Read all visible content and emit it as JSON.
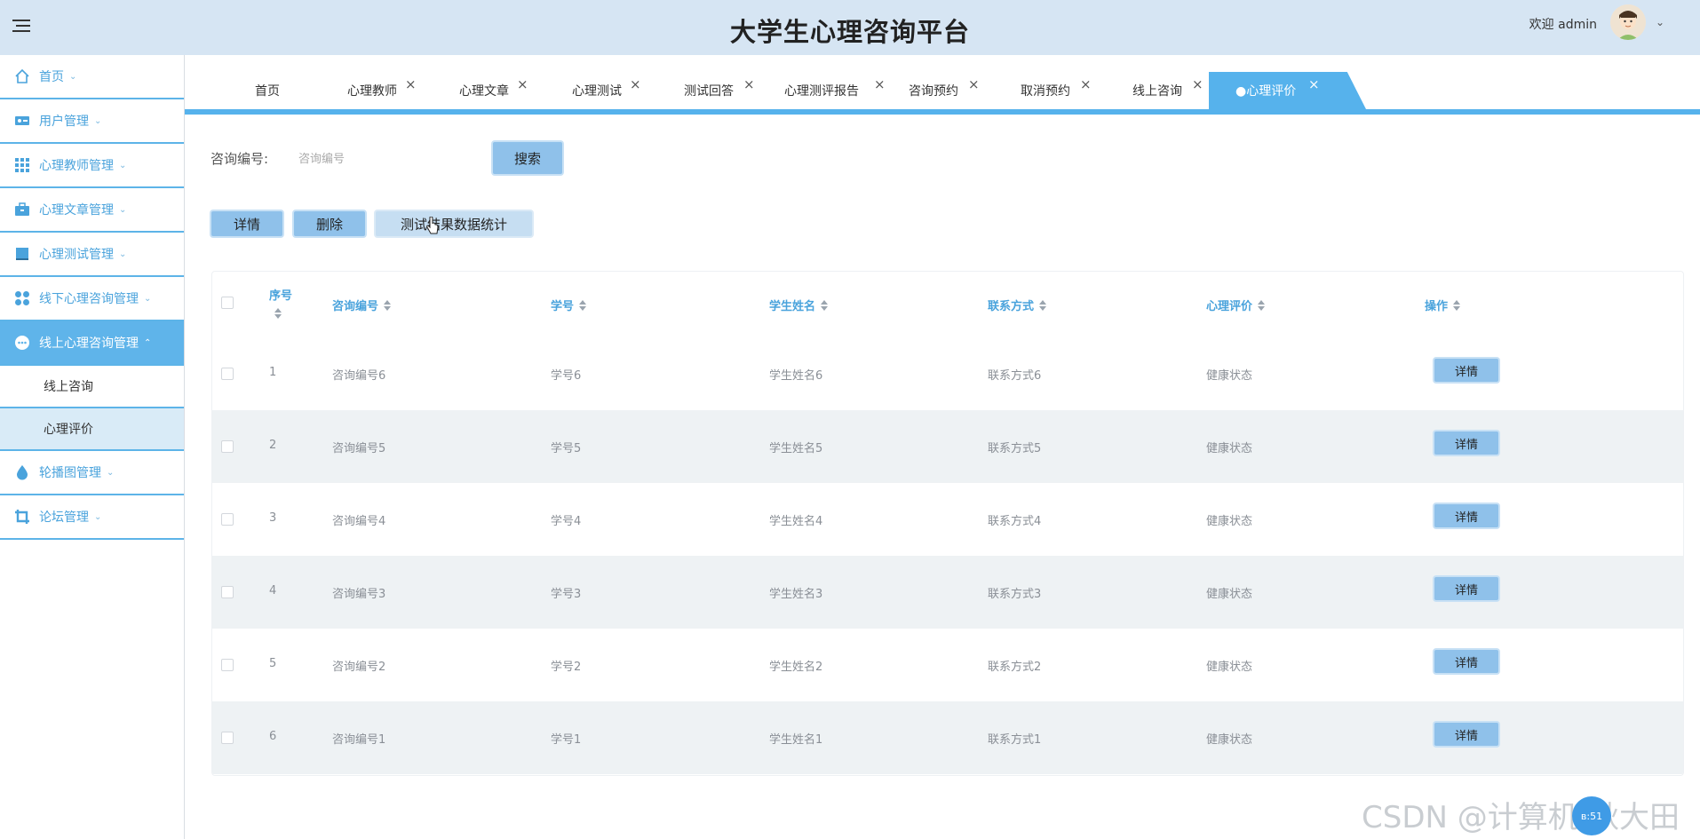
{
  "header": {
    "title": "大学生心理咨询平台",
    "welcome": "欢迎 admin",
    "caret": "⌄"
  },
  "sidebar": {
    "items": [
      {
        "label": "首页",
        "icon": "home-icon"
      },
      {
        "label": "用户管理",
        "icon": "user-card-icon"
      },
      {
        "label": "心理教师管理",
        "icon": "grid-icon"
      },
      {
        "label": "心理文章管理",
        "icon": "briefcase-icon"
      },
      {
        "label": "心理测试管理",
        "icon": "monitor-icon"
      },
      {
        "label": "线下心理咨询管理",
        "icon": "apps-icon"
      },
      {
        "label": "线上心理咨询管理",
        "icon": "chat-icon",
        "active": true
      }
    ],
    "sub_items": [
      {
        "label": "线上咨询"
      },
      {
        "label": "心理评价",
        "selected": true
      }
    ],
    "items_after": [
      {
        "label": "轮播图管理",
        "icon": "drop-icon"
      },
      {
        "label": "论坛管理",
        "icon": "crop-icon"
      }
    ],
    "chevron_down": "⌄",
    "chevron_up": "⌃"
  },
  "tabs": [
    {
      "label": "首页"
    },
    {
      "label": "心理教师"
    },
    {
      "label": "心理文章"
    },
    {
      "label": "心理测试"
    },
    {
      "label": "测试回答"
    },
    {
      "label": "心理测评报告"
    },
    {
      "label": "咨询预约"
    },
    {
      "label": "取消预约"
    },
    {
      "label": "线上咨询"
    },
    {
      "label": "●心理评价",
      "active": true
    }
  ],
  "close_glyph": "×",
  "search": {
    "label": "咨询编号:",
    "placeholder": "咨询编号",
    "button": "搜索"
  },
  "actions": {
    "detail": "详情",
    "delete": "删除",
    "stats": "测试结果数据统计"
  },
  "table": {
    "columns": [
      "序号",
      "咨询编号",
      "学号",
      "学生姓名",
      "联系方式",
      "心理评价",
      "操作"
    ],
    "rows": [
      {
        "no": "1",
        "code": "咨询编号6",
        "sid": "学号6",
        "name": "学生姓名6",
        "contact": "联系方式6",
        "eval": "健康状态",
        "action": "详情"
      },
      {
        "no": "2",
        "code": "咨询编号5",
        "sid": "学号5",
        "name": "学生姓名5",
        "contact": "联系方式5",
        "eval": "健康状态",
        "action": "详情"
      },
      {
        "no": "3",
        "code": "咨询编号4",
        "sid": "学号4",
        "name": "学生姓名4",
        "contact": "联系方式4",
        "eval": "健康状态",
        "action": "详情"
      },
      {
        "no": "4",
        "code": "咨询编号3",
        "sid": "学号3",
        "name": "学生姓名3",
        "contact": "联系方式3",
        "eval": "健康状态",
        "action": "详情"
      },
      {
        "no": "5",
        "code": "咨询编号2",
        "sid": "学号2",
        "name": "学生姓名2",
        "contact": "联系方式2",
        "eval": "健康状态",
        "action": "详情"
      },
      {
        "no": "6",
        "code": "咨询编号1",
        "sid": "学号1",
        "name": "学生姓名1",
        "contact": "联系方式1",
        "eval": "健康状态",
        "action": "详情"
      }
    ]
  },
  "watermark": "CSDN @计算机-秋大田",
  "float_button": "в:51",
  "colors": {
    "accent": "#56b2ec",
    "header_bg": "#d6e5f3",
    "button": "#8fc1ea",
    "link_text": "#4aa3dc"
  }
}
